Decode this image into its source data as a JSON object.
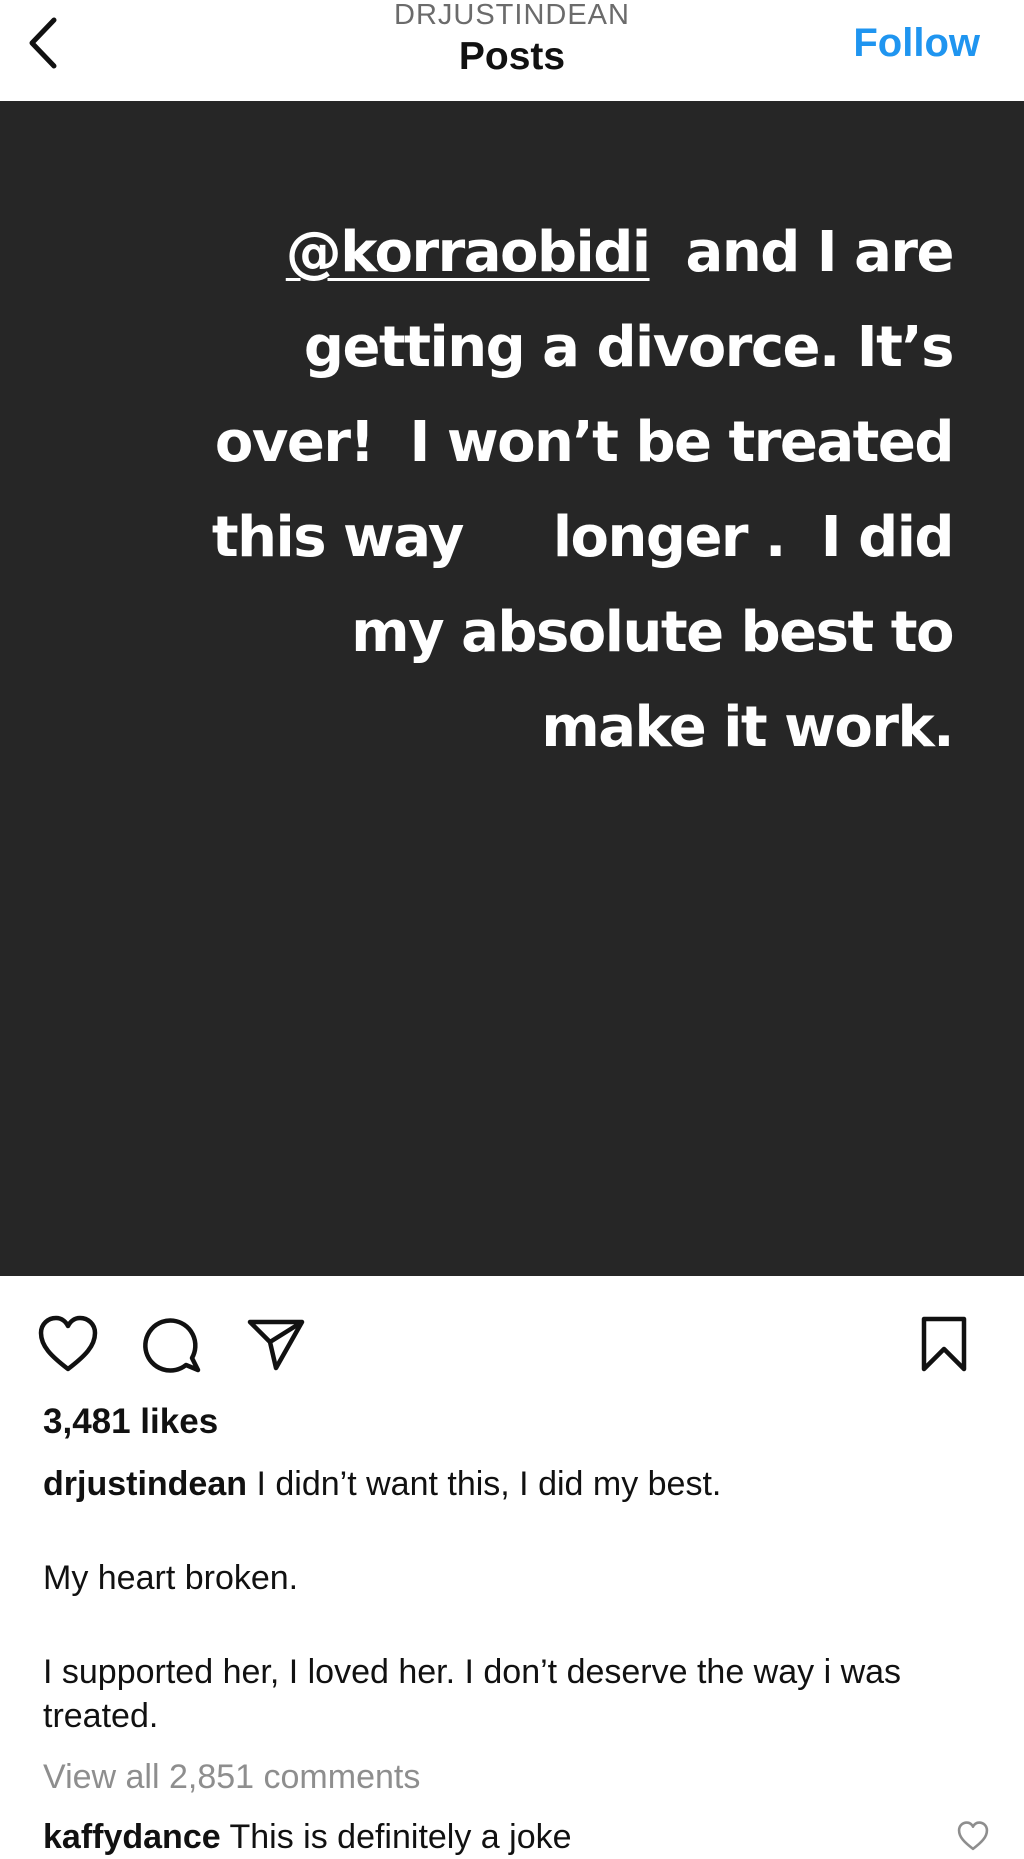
{
  "header": {
    "username": "DRJUSTINDEAN",
    "title": "Posts",
    "follow_label": "Follow",
    "back_icon": "chevron-left-icon",
    "accent_color": "#1f95f0"
  },
  "post": {
    "background_color": "#262626",
    "text_lines": [
      {
        "mention": "@korraobidi",
        "rest": "  and I are"
      },
      {
        "text": "getting a divorce. It’s"
      },
      {
        "text": "over!  I won’t be treated"
      },
      {
        "text": "this way     longer .  I did"
      },
      {
        "text": "my absolute best to"
      },
      {
        "text": "make it work."
      }
    ]
  },
  "actions": {
    "like_icon": "heart-icon",
    "comment_icon": "comment-bubble-icon",
    "share_icon": "paper-plane-icon",
    "save_icon": "bookmark-icon"
  },
  "likes": "3,481 likes",
  "caption": {
    "author": "drjustindean",
    "line1": "I didn’t want this, I did my best.",
    "para2": "My heart broken.",
    "para3": "I supported her, I loved her. I don’t deserve the way i was treated."
  },
  "comments": {
    "view_all": "View all 2,851 comments",
    "items": [
      {
        "user": "kaffydance",
        "text": "This is definitely a joke",
        "like_icon": "heart-outline-icon"
      }
    ]
  }
}
